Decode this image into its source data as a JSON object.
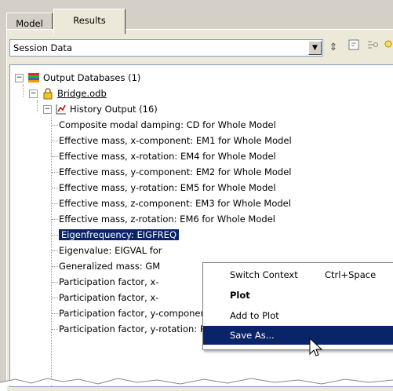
{
  "tabs": [
    {
      "label": "Model",
      "active": false
    },
    {
      "label": "Results",
      "active": true
    }
  ],
  "session": {
    "value": "Session Data"
  },
  "toolbar": {
    "icons": [
      "up-down-arrows-icon",
      "expand-tree-icon",
      "filter-icon",
      "bulb-icon"
    ]
  },
  "tree": {
    "root_label": "Output Databases (1)",
    "odb_label": "Bridge.odb",
    "history_label": "History Output (16)",
    "items": [
      "Composite modal damping: CD for Whole Model",
      "Effective mass, x-component: EM1 for Whole Model",
      "Effective mass, x-rotation: EM4 for Whole Model",
      "Effective mass, y-component: EM2 for Whole Model",
      "Effective mass, y-rotation: EM5 for Whole Model",
      "Effective mass, z-component: EM3 for Whole Model",
      "Effective mass, z-rotation: EM6 for Whole Model",
      "Eigenfrequency: EIGFREQ",
      "Eigenvalue: EIGVAL for",
      "Generalized mass: GM",
      "Participation factor, x-",
      "Participation factor, x-",
      "Participation factor, y-component: PF2 for Whole Model",
      "Participation factor, y-rotation: PF5 for Whole Model"
    ],
    "selected_index": 7
  },
  "context_menu": {
    "items": [
      {
        "label": "Switch Context",
        "shortcut": "Ctrl+Space"
      },
      {
        "label": "Plot",
        "shortcut": ""
      },
      {
        "label": "Add to Plot",
        "shortcut": ""
      },
      {
        "label": "Save As...",
        "shortcut": ""
      }
    ],
    "highlighted_index": 3
  },
  "colors": {
    "selection": "#0a246a",
    "panel": "#ece9d8"
  }
}
